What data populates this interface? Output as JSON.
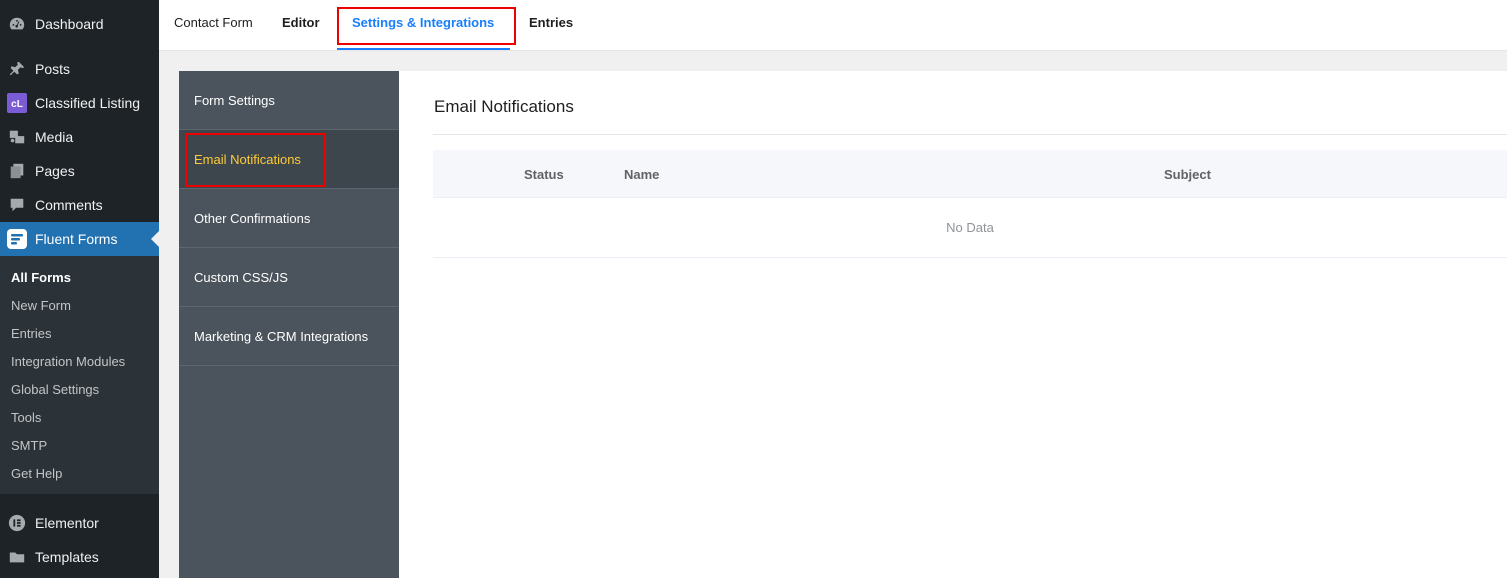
{
  "wp_menu": {
    "top_items": [
      {
        "label": "Dashboard",
        "icon": "dashboard-icon"
      },
      {
        "label": "Posts",
        "icon": "pin-icon"
      },
      {
        "label": "Classified Listing",
        "icon": "classified-listing-icon"
      },
      {
        "label": "Media",
        "icon": "media-icon"
      },
      {
        "label": "Pages",
        "icon": "pages-icon"
      },
      {
        "label": "Comments",
        "icon": "comment-icon"
      },
      {
        "label": "Fluent Forms",
        "icon": "fluent-forms-icon"
      }
    ],
    "submenu": [
      "All Forms",
      "New Form",
      "Entries",
      "Integration Modules",
      "Global Settings",
      "Tools",
      "SMTP",
      "Get Help"
    ],
    "bottom_items": [
      {
        "label": "Elementor",
        "icon": "elementor-icon"
      },
      {
        "label": "Templates",
        "icon": "folder-icon"
      }
    ],
    "active": "Fluent Forms",
    "current_sub": "All Forms"
  },
  "tabs": {
    "form_name": "Contact Form",
    "editor": "Editor",
    "settings": "Settings & Integrations",
    "entries": "Entries"
  },
  "settings_nav": [
    "Form Settings",
    "Email Notifications",
    "Other Confirmations",
    "Custom CSS/JS",
    "Marketing & CRM Integrations"
  ],
  "content": {
    "title": "Email Notifications",
    "columns": [
      "Status",
      "Name",
      "Subject"
    ],
    "empty_text": "No Data"
  },
  "colors": {
    "accent": "#1a7efb",
    "active_menu": "#2271b1",
    "highlight": "#ffcc35",
    "annotation": "#ee0000"
  }
}
